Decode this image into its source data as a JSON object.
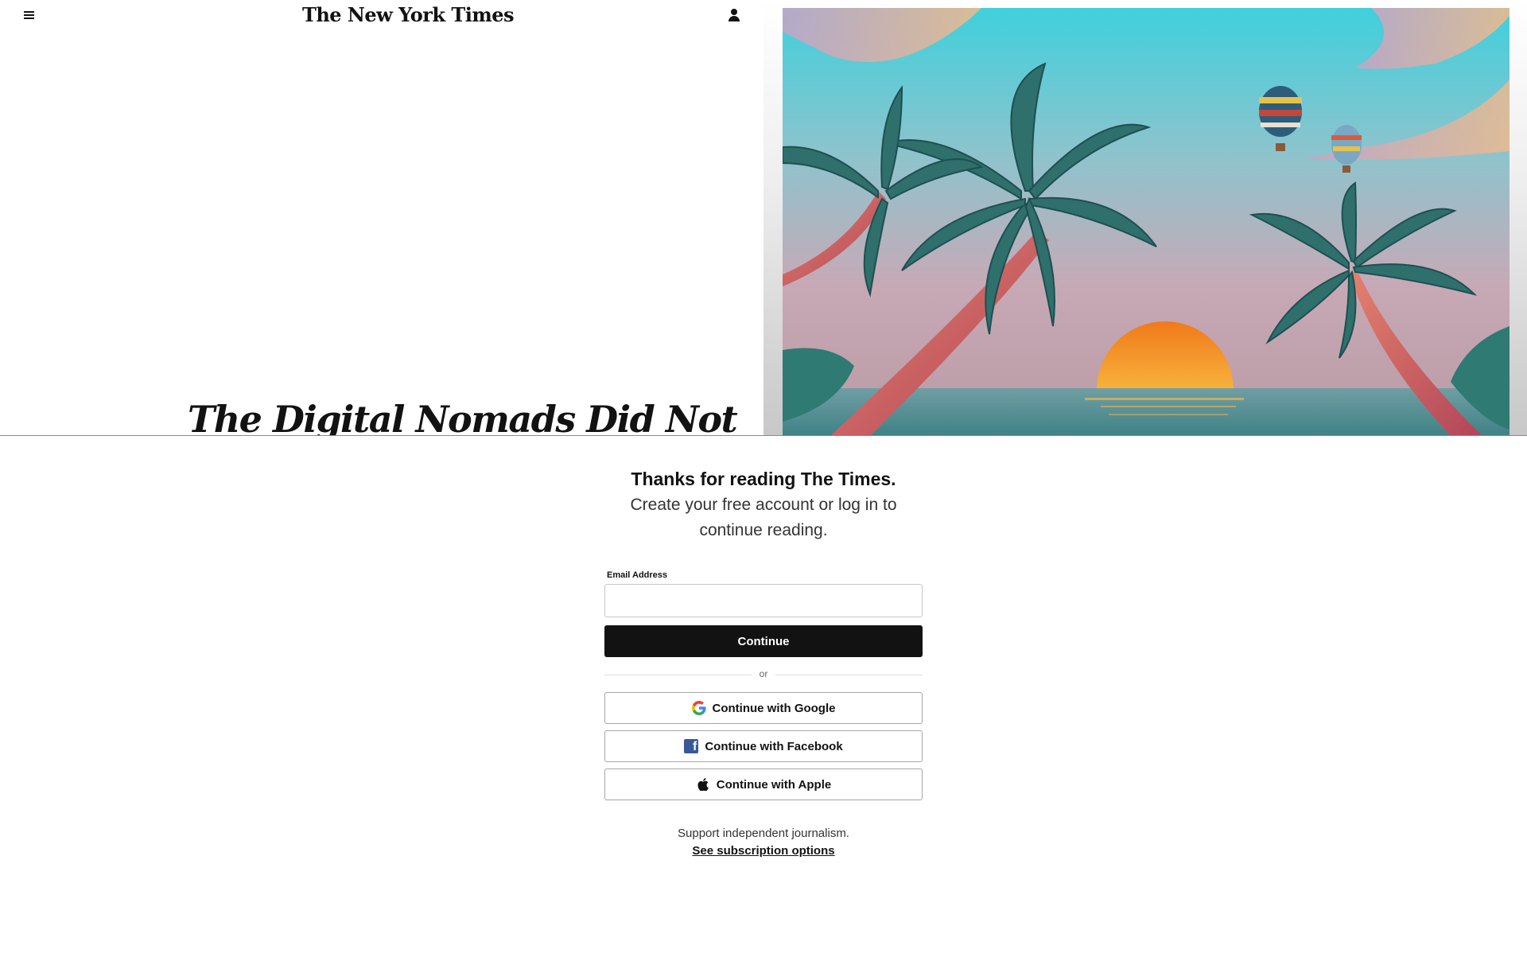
{
  "header": {
    "masthead": "The New York Times",
    "menu_icon": "hamburger-menu-icon",
    "account_icon": "person-icon"
  },
  "article": {
    "headline": "The Digital Nomads Did Not",
    "hero_image": "illustration-palm-trees-sunset-hot-air-balloons"
  },
  "paywall": {
    "title": "Thanks for reading The Times.",
    "subtitle": "Create your free account or log in to continue reading.",
    "email_label": "Email Address",
    "email_value": "",
    "continue_label": "Continue",
    "divider_text": "or",
    "google_label": "Continue with Google",
    "facebook_label": "Continue with Facebook",
    "apple_label": "Continue with Apple",
    "support_text": "Support independent journalism.",
    "subscription_link": "See subscription options"
  },
  "colors": {
    "text": "#121212",
    "button_dark": "#121212",
    "facebook_blue": "#3b5998",
    "sky_top": "#3fd0dc",
    "sun": "#f0891e"
  }
}
